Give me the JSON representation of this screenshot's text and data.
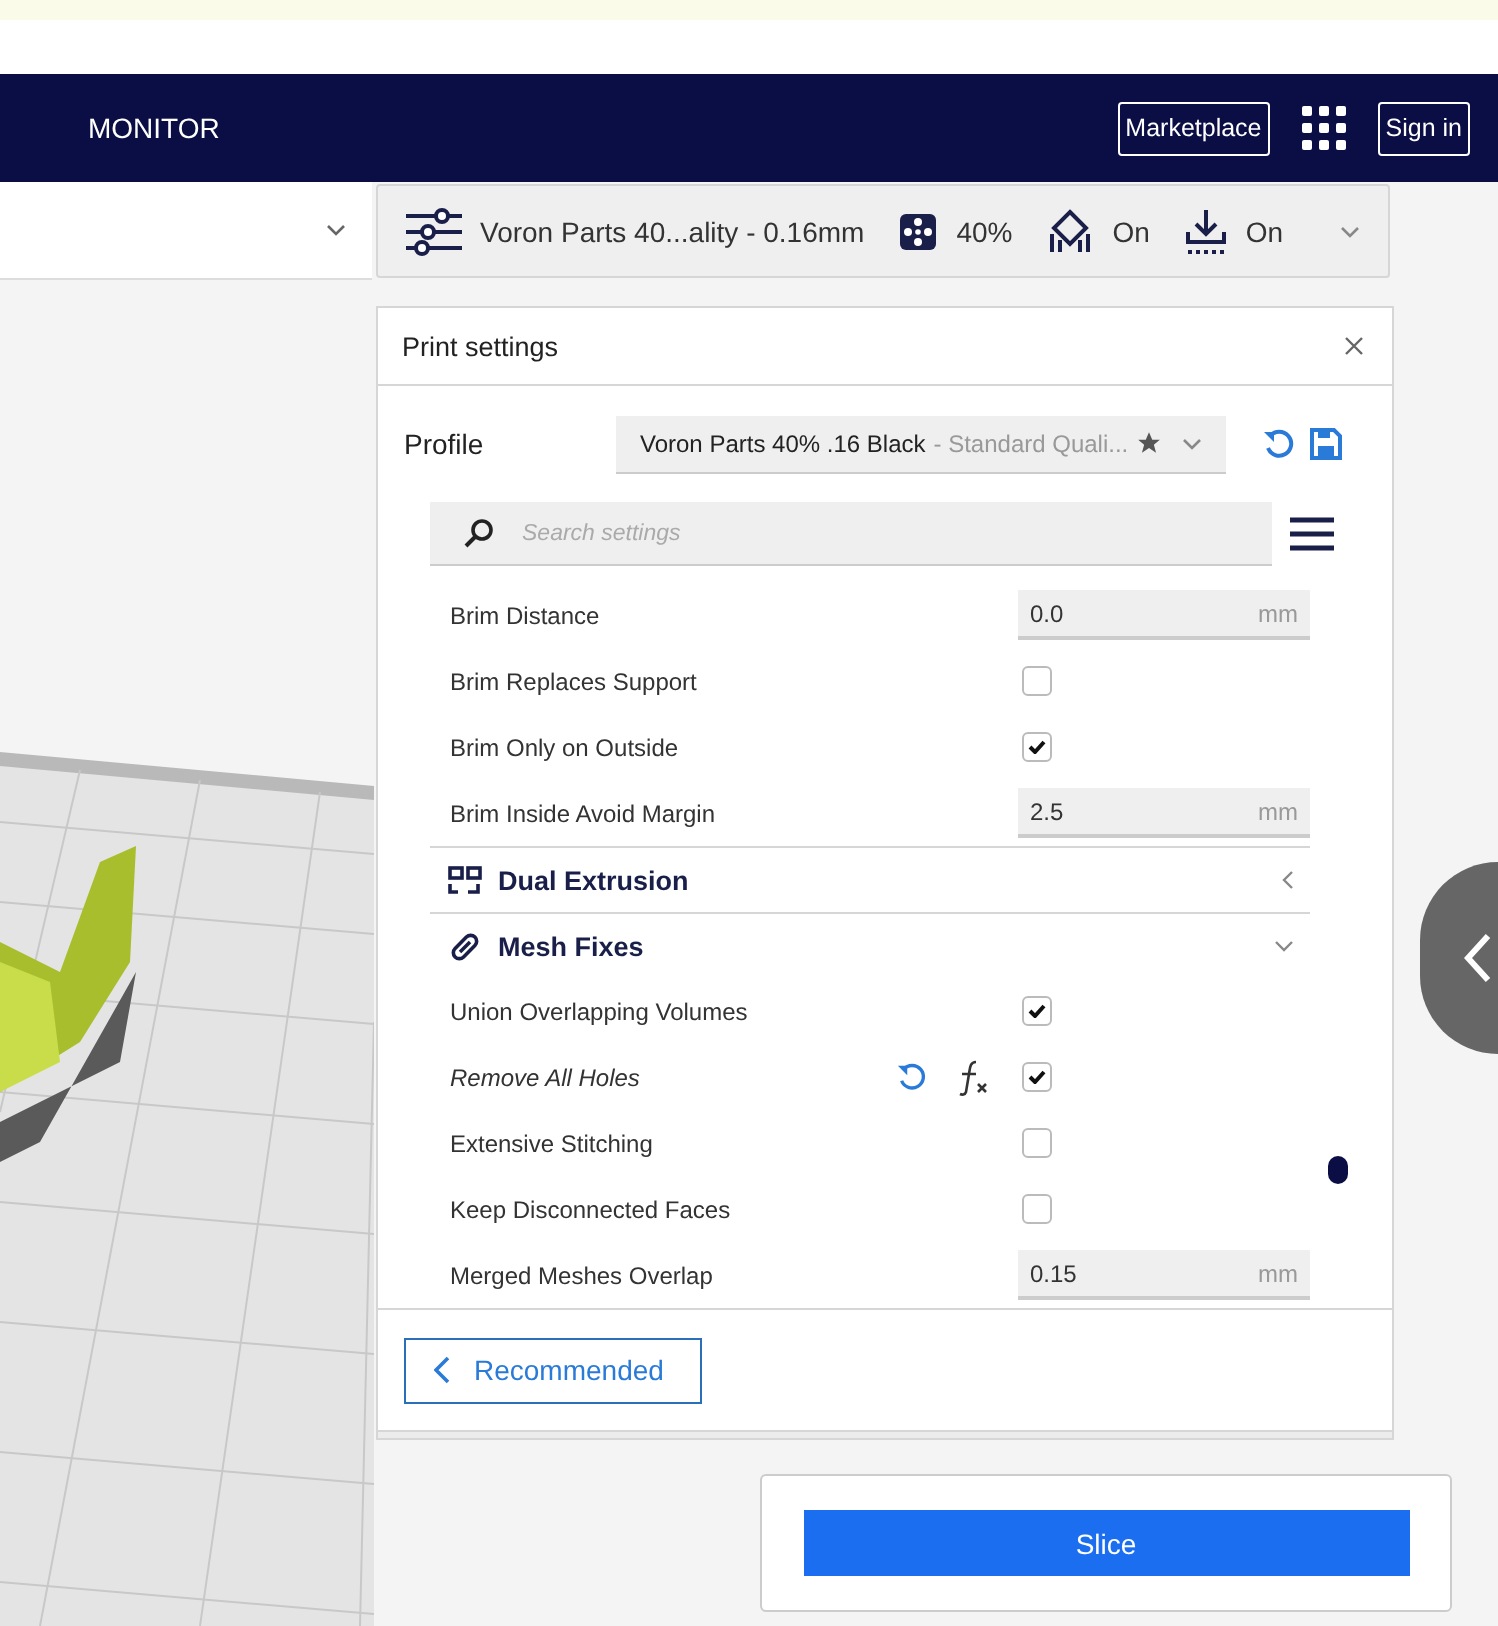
{
  "header": {
    "nav_label": "MONITOR",
    "marketplace_button": "Marketplace",
    "sign_in_button": "Sign in"
  },
  "print_setup_bar": {
    "profile": "Voron Parts 40...ality - 0.16mm",
    "infill": "40%",
    "support": "On",
    "adhesion": "On"
  },
  "print_settings": {
    "title": "Print settings",
    "profile_label": "Profile",
    "profile_name": "Voron Parts 40% .16 Black",
    "profile_quality": "- Standard Quali...",
    "search": {
      "placeholder": "Search settings"
    },
    "rows": [
      {
        "kind": "number",
        "label": "Brim Distance",
        "value": "0.0",
        "unit": "mm",
        "modified": false
      },
      {
        "kind": "checkbox",
        "label": "Brim Replaces Support",
        "checked": false,
        "modified": false
      },
      {
        "kind": "checkbox",
        "label": "Brim Only on Outside",
        "checked": true,
        "modified": false
      },
      {
        "kind": "number",
        "label": "Brim Inside Avoid Margin",
        "value": "2.5",
        "unit": "mm",
        "modified": false
      },
      {
        "kind": "category",
        "label": "Dual Extrusion",
        "expanded": false
      },
      {
        "kind": "category",
        "label": "Mesh Fixes",
        "expanded": true
      },
      {
        "kind": "checkbox",
        "label": "Union Overlapping Volumes",
        "checked": true,
        "modified": false
      },
      {
        "kind": "checkbox",
        "label": "Remove All Holes",
        "checked": true,
        "modified": true
      },
      {
        "kind": "checkbox",
        "label": "Extensive Stitching",
        "checked": false,
        "modified": false
      },
      {
        "kind": "checkbox",
        "label": "Keep Disconnected Faces",
        "checked": false,
        "modified": false
      },
      {
        "kind": "number",
        "label": "Merged Meshes Overlap",
        "value": "0.15",
        "unit": "mm",
        "modified": false
      }
    ],
    "recommended_button": "Recommended"
  },
  "slice_button": "Slice"
}
